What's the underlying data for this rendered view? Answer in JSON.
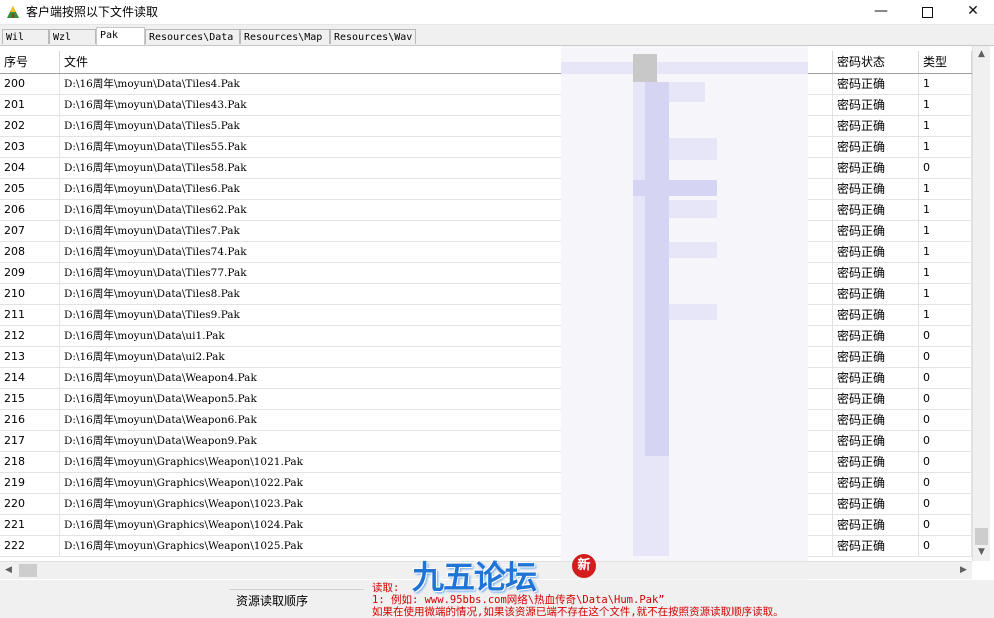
{
  "window": {
    "title": "客户端按照以下文件读取",
    "min_glyph": "—",
    "close_glyph": "✕"
  },
  "tabs": [
    "Wil",
    "Wzl",
    "Pak",
    "Resources\\Data",
    "Resources\\Map",
    "Resources\\Wav"
  ],
  "active_tab": "Pak",
  "table": {
    "headers": {
      "no": "序号",
      "file": "文件",
      "status": "密码状态",
      "type": "类型"
    },
    "rows": [
      {
        "no": "200",
        "file": "D:\\16周年\\moyun\\Data\\Tiles4.Pak",
        "status": "密码正确",
        "type": "1"
      },
      {
        "no": "201",
        "file": "D:\\16周年\\moyun\\Data\\Tiles43.Pak",
        "status": "密码正确",
        "type": "1"
      },
      {
        "no": "202",
        "file": "D:\\16周年\\moyun\\Data\\Tiles5.Pak",
        "status": "密码正确",
        "type": "1"
      },
      {
        "no": "203",
        "file": "D:\\16周年\\moyun\\Data\\Tiles55.Pak",
        "status": "密码正确",
        "type": "1"
      },
      {
        "no": "204",
        "file": "D:\\16周年\\moyun\\Data\\Tiles58.Pak",
        "status": "密码正确",
        "type": "0"
      },
      {
        "no": "205",
        "file": "D:\\16周年\\moyun\\Data\\Tiles6.Pak",
        "status": "密码正确",
        "type": "1"
      },
      {
        "no": "206",
        "file": "D:\\16周年\\moyun\\Data\\Tiles62.Pak",
        "status": "密码正确",
        "type": "1"
      },
      {
        "no": "207",
        "file": "D:\\16周年\\moyun\\Data\\Tiles7.Pak",
        "status": "密码正确",
        "type": "1"
      },
      {
        "no": "208",
        "file": "D:\\16周年\\moyun\\Data\\Tiles74.Pak",
        "status": "密码正确",
        "type": "1"
      },
      {
        "no": "209",
        "file": "D:\\16周年\\moyun\\Data\\Tiles77.Pak",
        "status": "密码正确",
        "type": "1"
      },
      {
        "no": "210",
        "file": "D:\\16周年\\moyun\\Data\\Tiles8.Pak",
        "status": "密码正确",
        "type": "1"
      },
      {
        "no": "211",
        "file": "D:\\16周年\\moyun\\Data\\Tiles9.Pak",
        "status": "密码正确",
        "type": "1"
      },
      {
        "no": "212",
        "file": "D:\\16周年\\moyun\\Data\\ui1.Pak",
        "status": "密码正确",
        "type": "0"
      },
      {
        "no": "213",
        "file": "D:\\16周年\\moyun\\Data\\ui2.Pak",
        "status": "密码正确",
        "type": "0"
      },
      {
        "no": "214",
        "file": "D:\\16周年\\moyun\\Data\\Weapon4.Pak",
        "status": "密码正确",
        "type": "0"
      },
      {
        "no": "215",
        "file": "D:\\16周年\\moyun\\Data\\Weapon5.Pak",
        "status": "密码正确",
        "type": "0"
      },
      {
        "no": "216",
        "file": "D:\\16周年\\moyun\\Data\\Weapon6.Pak",
        "status": "密码正确",
        "type": "0"
      },
      {
        "no": "217",
        "file": "D:\\16周年\\moyun\\Data\\Weapon9.Pak",
        "status": "密码正确",
        "type": "0"
      },
      {
        "no": "218",
        "file": "D:\\16周年\\moyun\\Graphics\\Weapon\\1021.Pak",
        "status": "密码正确",
        "type": "0"
      },
      {
        "no": "219",
        "file": "D:\\16周年\\moyun\\Graphics\\Weapon\\1022.Pak",
        "status": "密码正确",
        "type": "0"
      },
      {
        "no": "220",
        "file": "D:\\16周年\\moyun\\Graphics\\Weapon\\1023.Pak",
        "status": "密码正确",
        "type": "0"
      },
      {
        "no": "221",
        "file": "D:\\16周年\\moyun\\Graphics\\Weapon\\1024.Pak",
        "status": "密码正确",
        "type": "0"
      },
      {
        "no": "222",
        "file": "D:\\16周年\\moyun\\Graphics\\Weapon\\1025.Pak",
        "status": "密码正确",
        "type": "0"
      }
    ]
  },
  "scrollbars": {
    "up": "▲",
    "down": "▼",
    "left": "◀",
    "right": "▶"
  },
  "bottom": {
    "order_label": "资源读取顺序",
    "hint_lines": [
      "读取:",
      "1: 例如: www.95bbs.com网络\\热血传奇\\Data\\Hum.Pak”",
      "   如果在使用微端的情况,如果该资源已端不存在这个文件,就不在按照资源读取顺序读取。"
    ]
  },
  "watermark": {
    "logo_text": "九五论坛",
    "badge": "新",
    "colors": {
      "logo": "#1f74d6",
      "badge": "#d31c1c"
    }
  },
  "colors": {
    "hint_text": "#d40000",
    "tab_bg": "#f0f0f0",
    "panel_bg": "#ffffff"
  }
}
